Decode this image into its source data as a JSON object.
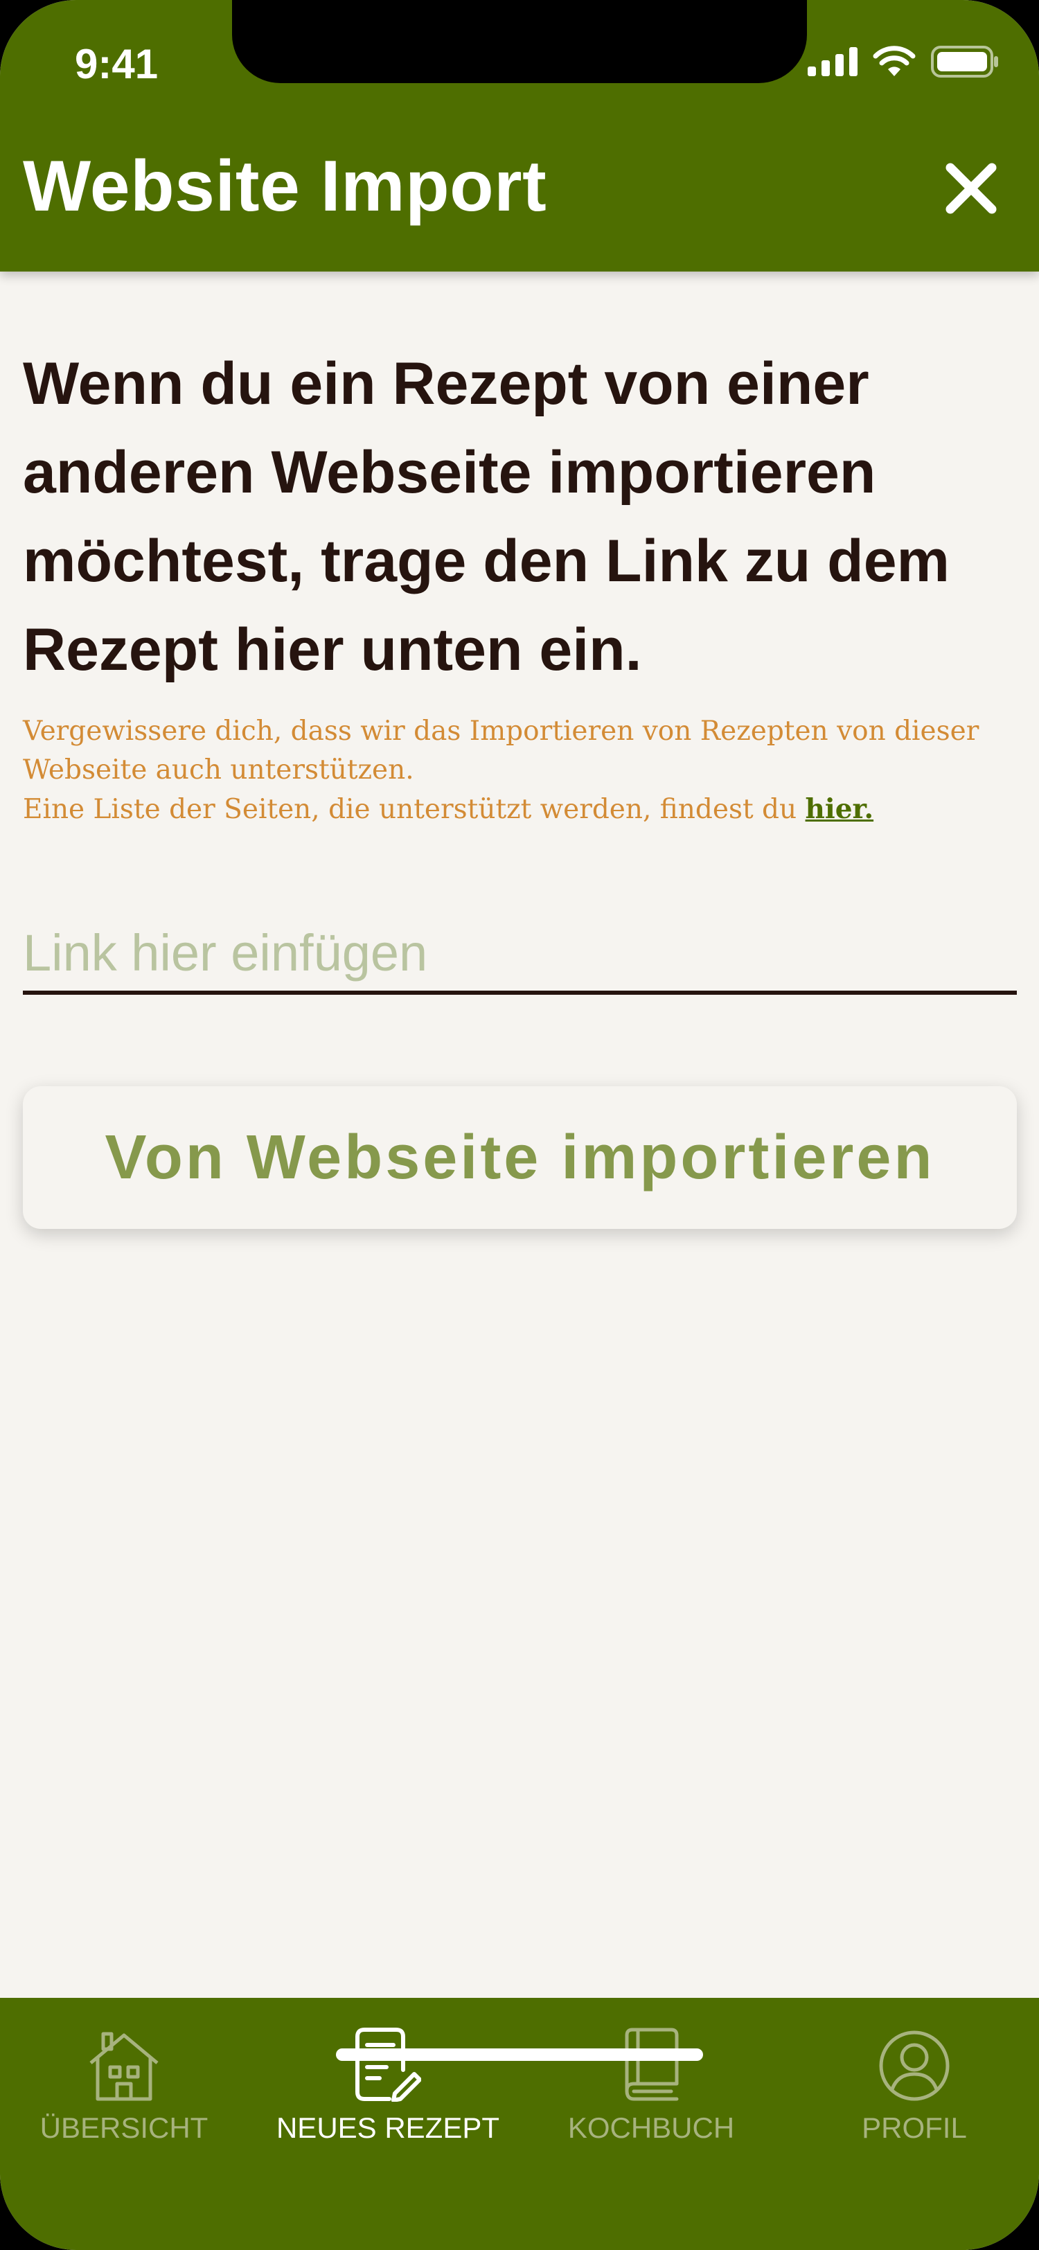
{
  "status_bar": {
    "time": "9:41"
  },
  "header": {
    "title": "Website Import"
  },
  "main": {
    "headline": "Wenn du ein Rezept von einer anderen Webseite importieren möchtest, trage den Link zu dem Rezept hier unten ein.",
    "info_line1": "Vergewissere dich, dass wir das Importieren von Rezepten von dieser Webseite auch unterstützen.",
    "info_line2": "Eine Liste der Seiten, die unterstützt werden, findest du ",
    "info_link": "hier.",
    "link_input": {
      "placeholder": "Link hier einfügen",
      "value": ""
    },
    "import_button": "Von Webseite importieren"
  },
  "bottom_nav": {
    "items": [
      {
        "label": "ÜBERSICHT",
        "icon": "home-icon",
        "active": false
      },
      {
        "label": "NEUES REZEPT",
        "icon": "new-recipe-icon",
        "active": true
      },
      {
        "label": "KOCHBUCH",
        "icon": "cookbook-icon",
        "active": false
      },
      {
        "label": "PROFIL",
        "icon": "profile-icon",
        "active": false
      }
    ]
  },
  "colors": {
    "brand_green": "#4e6e00",
    "background": "#f6f4f0",
    "headline_text": "#26140f",
    "info_text": "#d38b35",
    "button_text": "#86994c",
    "inactive_nav": "#a7b37e"
  }
}
